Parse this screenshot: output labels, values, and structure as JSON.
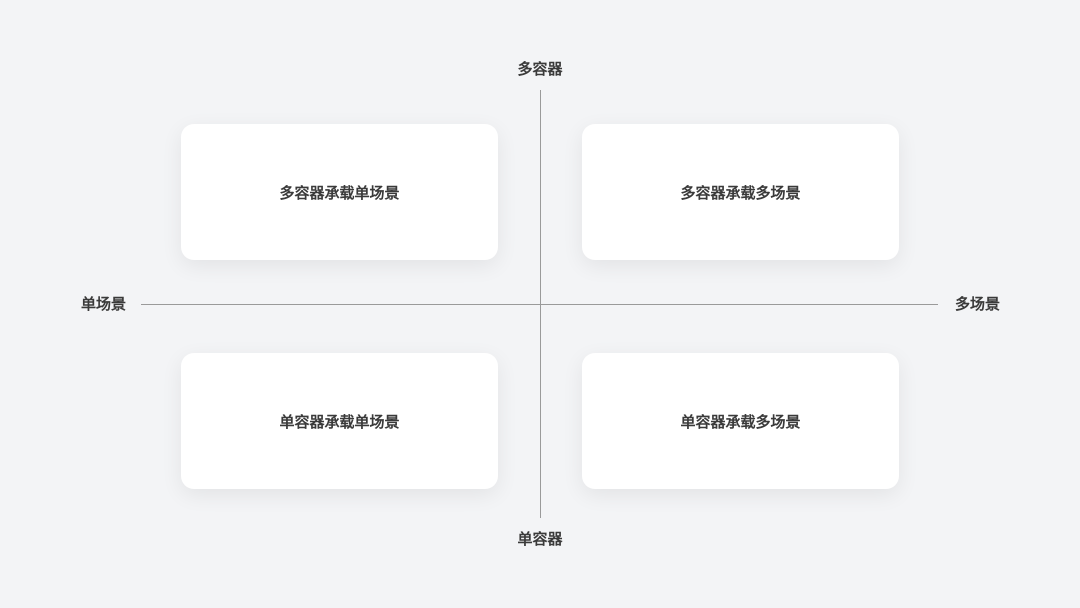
{
  "axes": {
    "top": "多容器",
    "bottom": "单容器",
    "left": "单场景",
    "right": "多场景"
  },
  "quadrants": {
    "top_left": "多容器承载单场景",
    "top_right": "多容器承载多场景",
    "bottom_left": "单容器承载单场景",
    "bottom_right": "单容器承载多场景"
  }
}
